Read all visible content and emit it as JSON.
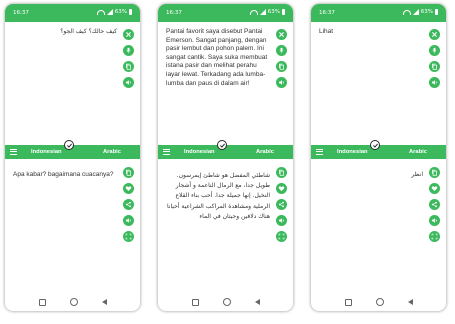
{
  "accent": "#3cb95c",
  "phones": [
    {
      "status": {
        "time": "16:37",
        "battery": "63%"
      },
      "source_text": "كيف حالك؟ كيف الجو؟",
      "target_text": "Apa kabar? bagaimana cuacanya?",
      "lang_bar": {
        "source": "Indonesian",
        "target": "Arabic"
      }
    },
    {
      "status": {
        "time": "16:37",
        "battery": "63%"
      },
      "source_text": "Pantai favorit saya disebut Pantai Emerson. Sangat panjang, dengan pasir lembut dan pohon palem. Ini sangat cantik. Saya suka membuat istana pasir dan melihat perahu layar lewat. Terkadang ada lumba-lumba dan paus di dalam air!",
      "target_text": "شاطئي المفضل هو شاطئ إيمرسون. طويل جدا، مع الرمال الناعمة و أشجار النخيل. إنها جميلة جدا. أحب بناء القلاع الرملية ومشاهدة المراكب الشراعية أحيانا هناك دلافين وحيتان في الماء",
      "lang_bar": {
        "source": "Indonesian",
        "target": "Arabic"
      }
    },
    {
      "status": {
        "time": "16:37",
        "battery": "63%"
      },
      "source_text": "Lihat",
      "target_text": "انظر",
      "lang_bar": {
        "source": "Indonesian",
        "target": "Arabic"
      }
    }
  ],
  "icons": {
    "top_actions": [
      "close-icon",
      "mic-icon",
      "copy-icon",
      "speaker-icon"
    ],
    "bottom_actions": [
      "copy-icon",
      "favorite-icon",
      "share-icon",
      "speaker-icon",
      "fullscreen-icon"
    ],
    "lang_bar": [
      "menu-icon",
      "swap-languages-icon"
    ],
    "navigation": [
      "recents-nav-icon",
      "home-nav-icon",
      "back-nav-icon"
    ]
  }
}
